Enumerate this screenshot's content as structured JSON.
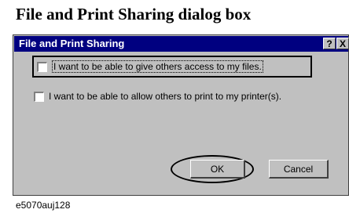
{
  "figure": {
    "heading": "File and Print Sharing dialog box",
    "caption": "e5070auj128"
  },
  "dialog": {
    "title": "File and Print Sharing",
    "help_symbol": "?",
    "close_symbol": "X",
    "options": [
      {
        "label": "I want to be able to give others access to my files.",
        "checked": false
      },
      {
        "label": "I want to be able to allow others to print to my printer(s).",
        "checked": false
      }
    ],
    "ok_label": "OK",
    "cancel_label": "Cancel"
  },
  "colors": {
    "titlebar": "#000080",
    "dialog_face": "#c0c0c0"
  }
}
